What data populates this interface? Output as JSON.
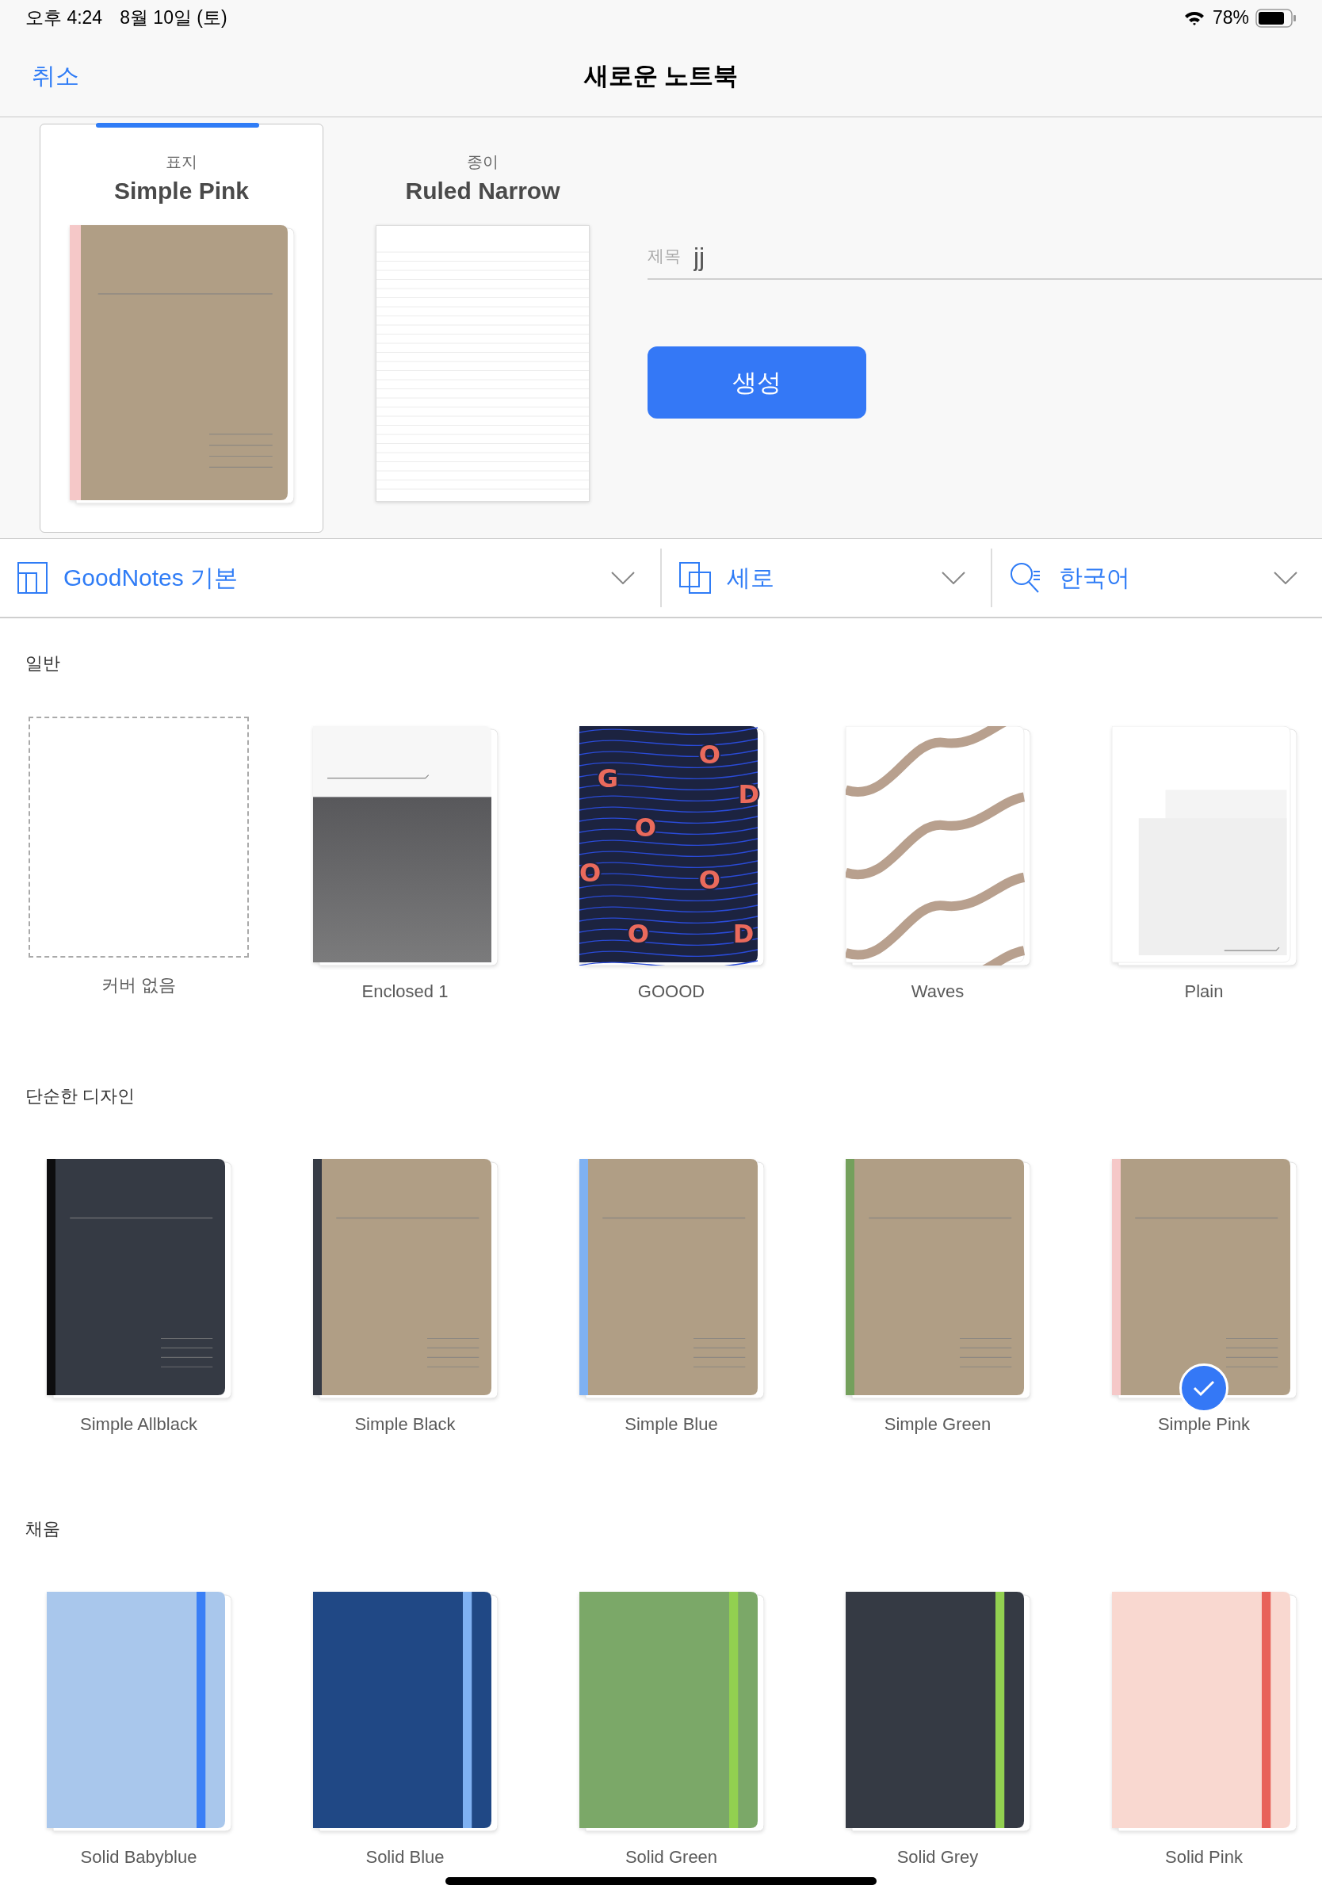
{
  "status_bar": {
    "time": "오후 4:24",
    "date": "8월 10일 (토)",
    "battery": "78%"
  },
  "nav": {
    "cancel": "취소",
    "title": "새로운 노트북"
  },
  "tabs": [
    {
      "kind": "cover",
      "label": "표지",
      "value": "Simple Pink",
      "selected": true,
      "color": "#b09e85",
      "spine": {
        "color": "#f5c8c8"
      }
    },
    {
      "kind": "paper",
      "label": "종이",
      "value": "Ruled Narrow",
      "selected": false
    }
  ],
  "title_field": {
    "label": "제목",
    "value": "jj"
  },
  "create_button": "생성",
  "toolbar": [
    {
      "kind": "template",
      "label": "GoodNotes 기본"
    },
    {
      "kind": "orientation",
      "label": "세로"
    },
    {
      "kind": "language",
      "label": "한국어"
    }
  ],
  "sections": [
    {
      "heading": "일반",
      "covers": [
        {
          "kind": "none",
          "name": "커버 없음",
          "selected": false
        },
        {
          "kind": "enclosed",
          "name": "Enclosed 1",
          "selected": false
        },
        {
          "kind": "goood",
          "name": "GOOOD",
          "selected": false,
          "letters": [
            "O",
            "G",
            "D",
            "O",
            "O",
            "O",
            "O",
            "D"
          ]
        },
        {
          "kind": "waves",
          "name": "Waves",
          "selected": false
        },
        {
          "kind": "plain",
          "name": "Plain",
          "selected": false
        }
      ]
    },
    {
      "heading": "단순한 디자인",
      "covers": [
        {
          "kind": "simple",
          "name": "Simple Allblack",
          "selected": false,
          "color": "#353a44",
          "spine": {
            "color": "#0d0d0f"
          }
        },
        {
          "kind": "simple",
          "name": "Simple Black",
          "selected": false,
          "color": "#b09e85",
          "spine": {
            "color": "#353a44"
          }
        },
        {
          "kind": "simple",
          "name": "Simple Blue",
          "selected": false,
          "color": "#b09e85",
          "spine": {
            "color": "#7fb1f2"
          }
        },
        {
          "kind": "simple",
          "name": "Simple Green",
          "selected": false,
          "color": "#b09e85",
          "spine": {
            "color": "#74a05c"
          }
        },
        {
          "kind": "simple",
          "name": "Simple Pink",
          "selected": true,
          "color": "#b09e85",
          "spine": {
            "color": "#f5c8c8"
          }
        }
      ]
    },
    {
      "heading": "채움",
      "covers": [
        {
          "kind": "solid",
          "name": "Solid Babyblue",
          "selected": false,
          "color": "#a9c7ec",
          "stripe": {
            "color": "#3a7ff6"
          }
        },
        {
          "kind": "solid",
          "name": "Solid Blue",
          "selected": false,
          "color": "#204885",
          "stripe": {
            "color": "#7fb1f2"
          }
        },
        {
          "kind": "solid",
          "name": "Solid Green",
          "selected": false,
          "color": "#7ba868",
          "stripe": {
            "color": "#92d050"
          }
        },
        {
          "kind": "solid",
          "name": "Solid Grey",
          "selected": false,
          "color": "#353a44",
          "stripe": {
            "color": "#92d050"
          }
        },
        {
          "kind": "solid",
          "name": "Solid Pink",
          "selected": false,
          "color": "#f9d8d0",
          "stripe": {
            "color": "#e8625a"
          }
        }
      ]
    }
  ]
}
